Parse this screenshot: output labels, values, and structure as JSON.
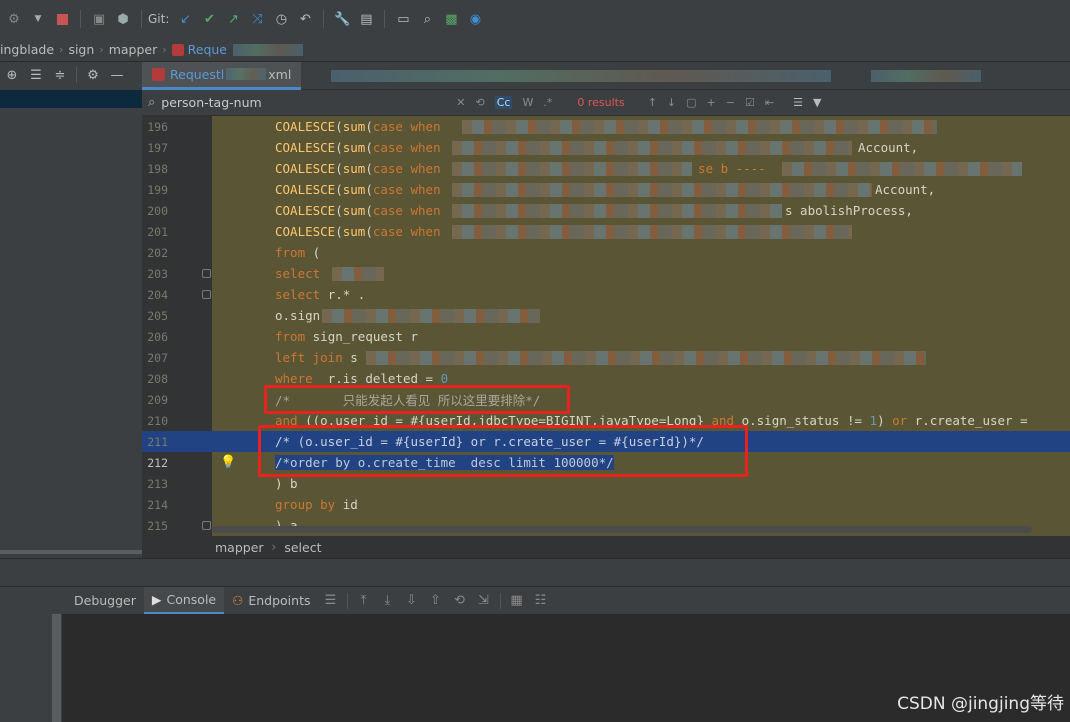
{
  "toolbar": {
    "git_label": "Git:",
    "icons": [
      "run-config-icon",
      "stop-icon",
      "coverage-icon",
      "build-icon",
      "git-update-icon",
      "git-commit-icon",
      "git-push-icon",
      "git-merge-icon",
      "history-icon",
      "rollback-icon",
      "settings-icon",
      "project-structure-icon",
      "terminal-icon",
      "search-icon",
      "monitor-icon",
      "check-icon"
    ]
  },
  "navbar": {
    "crumbs": [
      "ingblade",
      "sign",
      "mapper",
      "Reque"
    ]
  },
  "editor_tabs": [
    {
      "label": "Requestl",
      "suffix": "xml",
      "active": true
    }
  ],
  "search": {
    "query": "person-tag-num",
    "match_case": "Cc",
    "words": "W",
    "regex": ".*",
    "results": "0 results"
  },
  "code_lines": [
    {
      "n": "196",
      "text": "COALESCE(sum(case when"
    },
    {
      "n": "197",
      "text": "COALESCE(sum(case when",
      "tail": "Account,"
    },
    {
      "n": "198",
      "text": "COALESCE(sum(case when",
      "tail": "se b ----"
    },
    {
      "n": "199",
      "text": "COALESCE(sum(case when",
      "tail": "Account,"
    },
    {
      "n": "200",
      "text": "COALESCE(sum(case when",
      "tail": "s abolishProcess,"
    },
    {
      "n": "201",
      "text": "COALESCE(sum(case when"
    },
    {
      "n": "202",
      "text": "from ("
    },
    {
      "n": "203",
      "text": "select"
    },
    {
      "n": "204",
      "text": "select r.* ."
    },
    {
      "n": "205",
      "text": "o.sign"
    },
    {
      "n": "206",
      "text": "from sign_request r"
    },
    {
      "n": "207",
      "text": "left join s"
    },
    {
      "n": "208",
      "text": "where  r.is_deleted = 0"
    },
    {
      "n": "209",
      "text": "/*       只能发起人看见 所以这里要排除*/"
    },
    {
      "n": "210",
      "text": "and ((o.user_id = #{userId,jdbcType=BIGINT,javaType=Long} and o.sign_status != 1) or r.create_user ="
    },
    {
      "n": "211",
      "text": "/* (o.user_id = #{userId} or r.create_user = #{userId})*/"
    },
    {
      "n": "212",
      "text": "/*order by o.create_time  desc limit 100000*/"
    },
    {
      "n": "213",
      "text": ") b"
    },
    {
      "n": "214",
      "text": "group by id"
    },
    {
      "n": "215",
      "text": ") a"
    }
  ],
  "breadcrumb_bottom": [
    "mapper",
    "select"
  ],
  "debug_tabs": [
    "Debugger",
    "Console",
    "Endpoints"
  ],
  "watermark": "CSDN @jingjing等待"
}
